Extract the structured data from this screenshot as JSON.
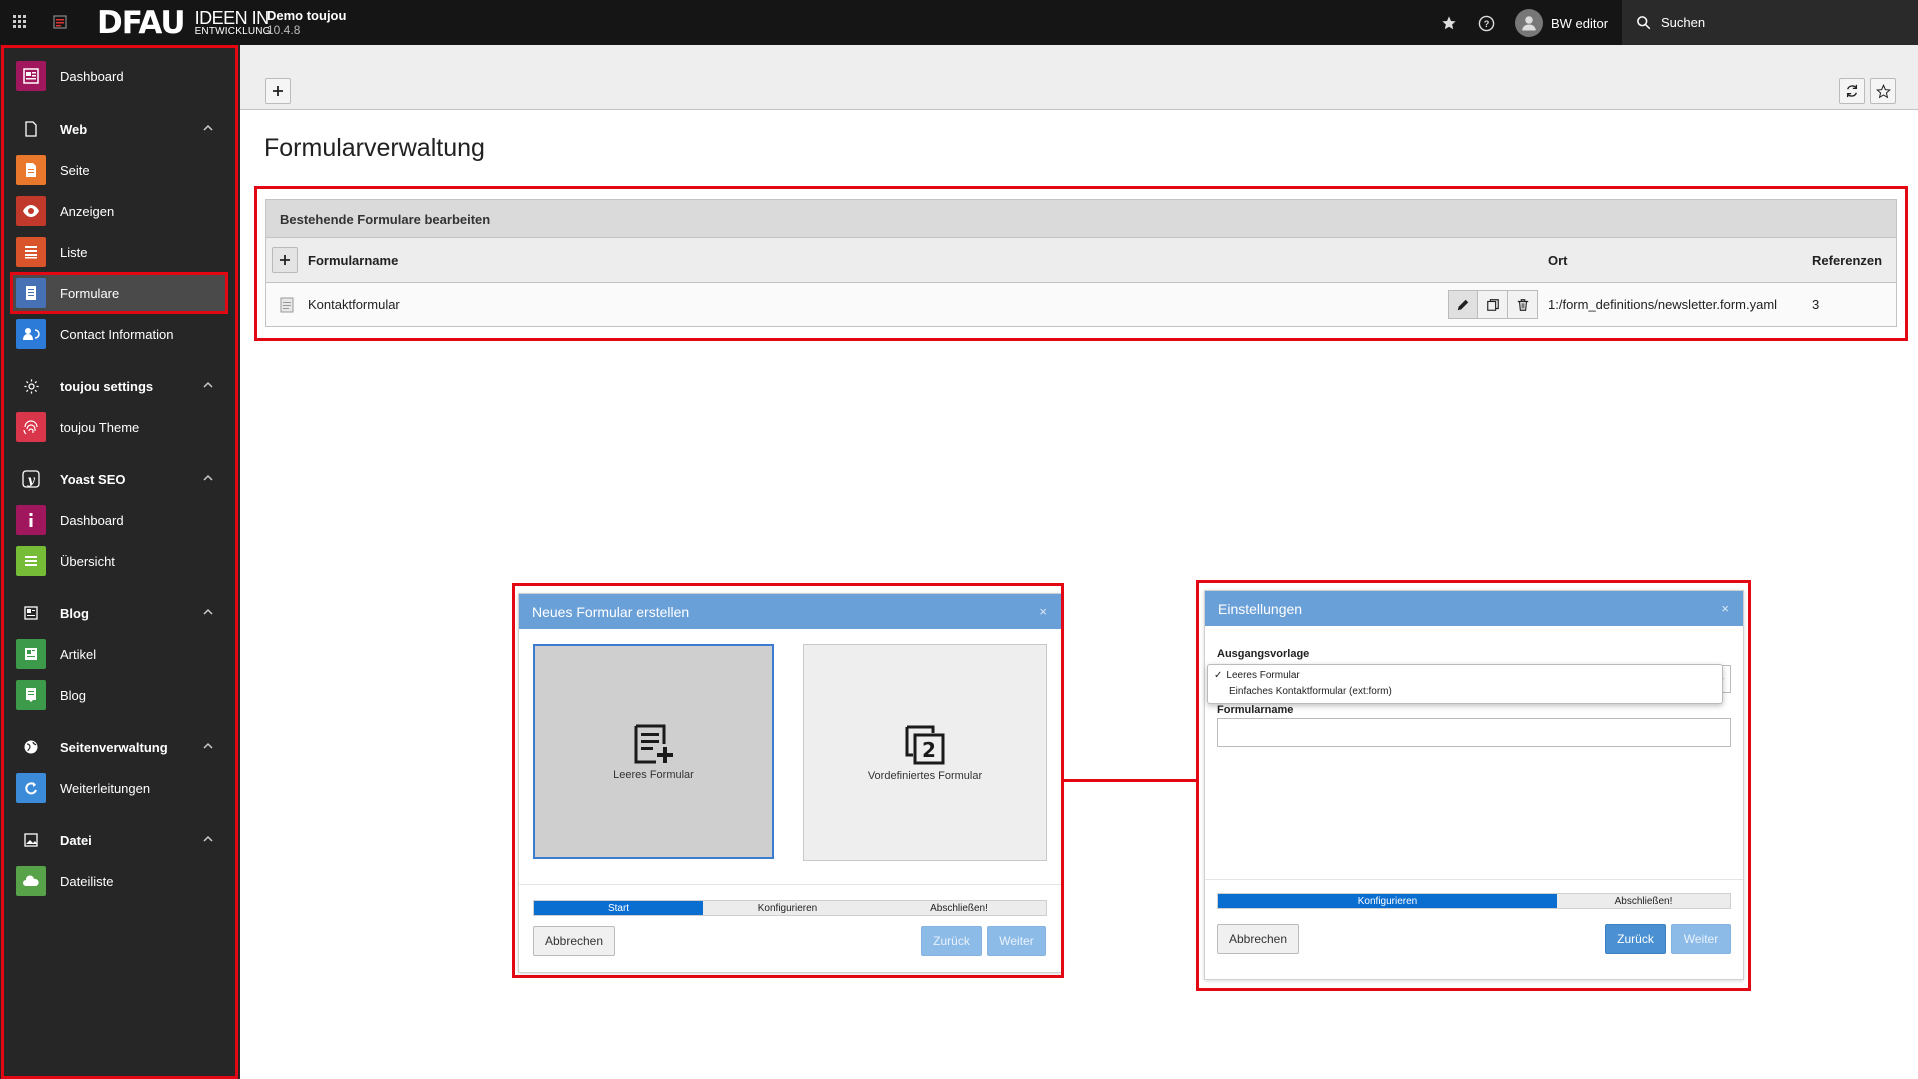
{
  "topbar": {
    "logo_main": "DFAU",
    "logo_line1": "IDEEN IN",
    "logo_line2": "ENTWICKLUNG",
    "site_name": "Demo toujou",
    "site_version": "10.4.8",
    "user_name": "BW editor",
    "search_label": "Suchen"
  },
  "sidebar": {
    "dashboard": "Dashboard",
    "web": "Web",
    "seite": "Seite",
    "anzeigen": "Anzeigen",
    "liste": "Liste",
    "formulare": "Formulare",
    "contact": "Contact Information",
    "toujou_settings": "toujou settings",
    "toujou_theme": "toujou Theme",
    "yoast": "Yoast SEO",
    "yoast_dashboard": "Dashboard",
    "uebersicht": "Übersicht",
    "blog_group": "Blog",
    "artikel": "Artikel",
    "blog": "Blog",
    "seitenverwaltung": "Seitenverwaltung",
    "weiterleitungen": "Weiterleitungen",
    "datei": "Datei",
    "dateiliste": "Dateiliste"
  },
  "colors": {
    "dashboard": "#a0175e",
    "seite": "#e9782d",
    "anzeigen": "#c0392b",
    "liste": "#d9542b",
    "formulare": "#4672b5",
    "contact": "#2d7bd9",
    "toujou": "#d9354b",
    "yoast_dash": "#a0175e",
    "uebersicht": "#77bc37",
    "artikel": "#3d9a4a",
    "blog": "#3d9a4a",
    "weiterleitungen": "#3b8bd8",
    "dateiliste": "#58a24a",
    "highlight": "#e30613"
  },
  "main": {
    "title": "Formularverwaltung",
    "panel_title": "Bestehende Formulare bearbeiten",
    "columns": {
      "name": "Formularname",
      "location": "Ort",
      "references": "Referenzen"
    },
    "rows": [
      {
        "name": "Kontaktformular",
        "location": "1:/form_definitions/newsletter.form.yaml",
        "references": "3"
      }
    ]
  },
  "wizard1": {
    "title": "Neues Formular erstellen",
    "close": "×",
    "option_blank": "Leeres Formular",
    "option_predefined": "Vordefiniertes Formular",
    "steps": [
      "Start",
      "Konfigurieren",
      "Abschließen!"
    ],
    "cancel": "Abbrechen",
    "back": "Zurück",
    "next": "Weiter"
  },
  "wizard2": {
    "title": "Einstellungen",
    "close": "×",
    "template_label": "Ausgangsvorlage",
    "template_options": [
      "Leeres Formular",
      "Einfaches Kontaktformular (ext:form)"
    ],
    "name_label": "Formularname",
    "name_value": "",
    "steps": [
      "Konfigurieren",
      "Abschließen!"
    ],
    "cancel": "Abbrechen",
    "back": "Zurück",
    "next": "Weiter"
  }
}
